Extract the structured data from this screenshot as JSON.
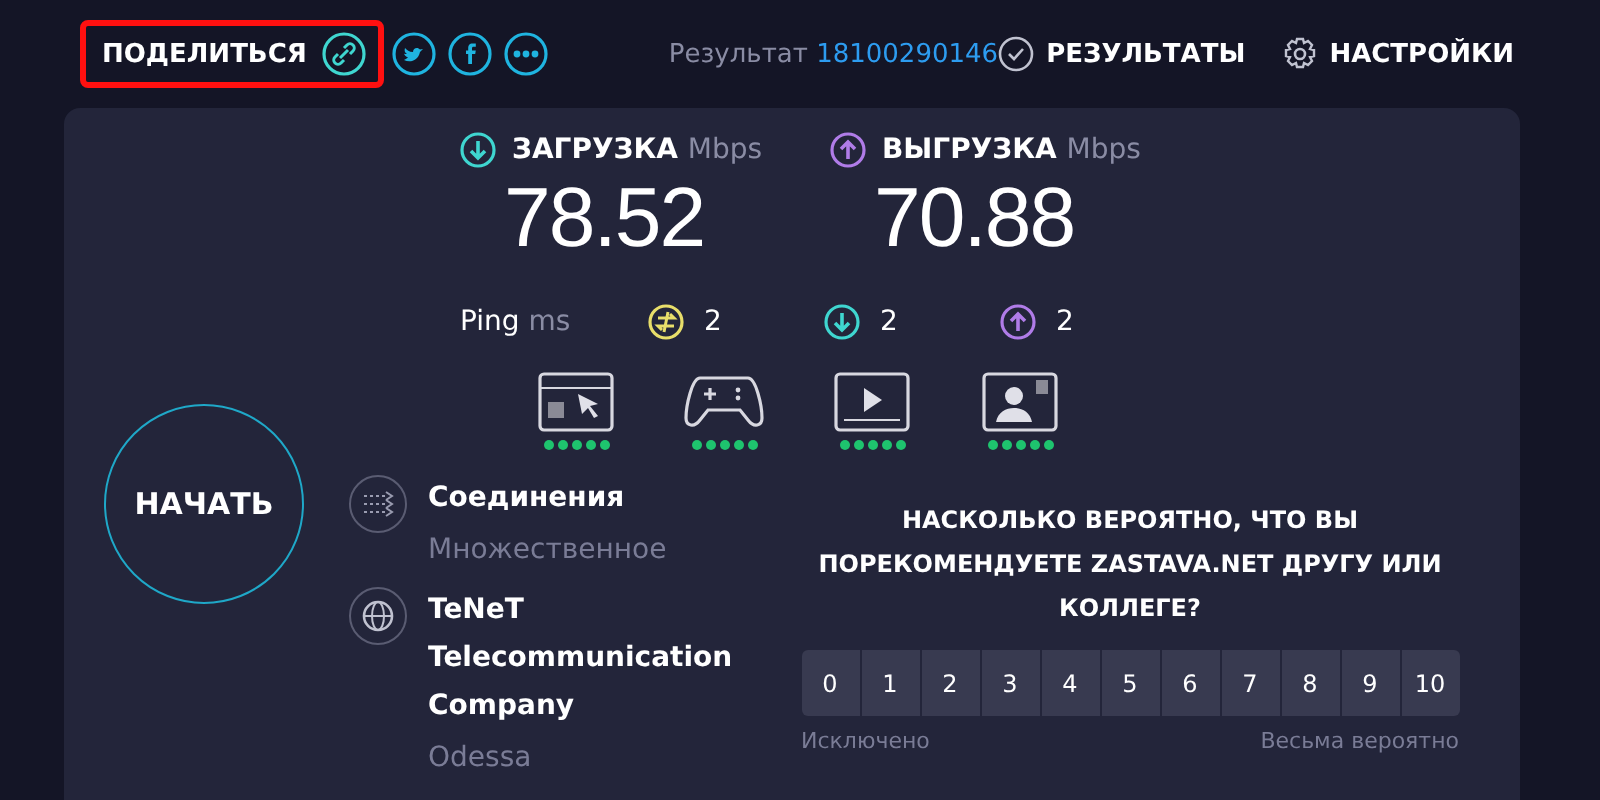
{
  "share": {
    "label": "ПОДЕЛИТЬСЯ",
    "highlighted": true
  },
  "result": {
    "label": "Результат",
    "number": "18100290146"
  },
  "nav": [
    {
      "kind": "results",
      "label": "РЕЗУЛЬТАТЫ"
    },
    {
      "kind": "settings",
      "label": "НАСТРОЙКИ"
    }
  ],
  "speeds": [
    {
      "kind": "download",
      "label": "ЗАГРУЗКА",
      "unit": "Mbps",
      "value": "78.52"
    },
    {
      "kind": "upload",
      "label": "ВЫГРУЗКА",
      "unit": "Mbps",
      "value": "70.88"
    }
  ],
  "ping": {
    "label": "Ping",
    "unit": "ms",
    "items": [
      {
        "kind": "ping",
        "value": "2"
      },
      {
        "kind": "download",
        "value": "2"
      },
      {
        "kind": "upload",
        "value": "2"
      }
    ]
  },
  "quality": [
    {
      "kind": "browsing",
      "stars": 5
    },
    {
      "kind": "gaming",
      "stars": 5
    },
    {
      "kind": "streaming",
      "stars": 5
    },
    {
      "kind": "video_call",
      "stars": 5
    }
  ],
  "start_button": "НАЧАТЬ",
  "connection": [
    {
      "kind": "connections",
      "title": "Соединения",
      "subtitle": "Множественное"
    },
    {
      "kind": "provider",
      "title": "TeNeT Telecommunication Company",
      "subtitle": "Odessa"
    }
  ],
  "survey": {
    "question": "НАСКОЛЬКО ВЕРОЯТНО, ЧТО ВЫ ПОРЕКОМЕНДУЕТЕ ZASTAVA.NET ДРУГУ ИЛИ КОЛЛЕГЕ?",
    "scale": [
      "0",
      "1",
      "2",
      "3",
      "4",
      "5",
      "6",
      "7",
      "8",
      "9",
      "10"
    ],
    "low_label": "Исключено",
    "high_label": "Весьма вероятно"
  }
}
